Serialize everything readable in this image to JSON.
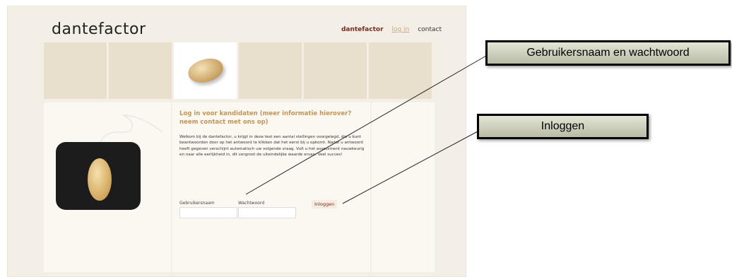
{
  "site": {
    "logo": "dantefactor"
  },
  "nav": {
    "home": "dantefactor",
    "login": "log in",
    "contact": "contact"
  },
  "content": {
    "heading": "Log in voor kandidaten (meer informatie hierover? neem contact met ons op)",
    "intro": "Welkom bij de dantefactor, u krijgt in deze test een aantal stellingen voorgelegd, die u kunt beantwoorden door op het antwoord te klikken dat het eerst bij u opkomt. Nadat u antwoord heeft gegeven verschijnt automatisch uw volgende vraag. Vult u het assessment nauwkeurig en naar alle eerlijkheid in, dit vergroot de uiteindelijke waarde ervan. Veel succes!",
    "username_label": "Gebruikersnaam",
    "password_label": "Wachtwoord",
    "username_value": "",
    "password_value": "",
    "login_button": "Inloggen"
  },
  "annotations": {
    "credentials": "Gebruikersnaam en wachtwoord",
    "login": "Inloggen"
  }
}
